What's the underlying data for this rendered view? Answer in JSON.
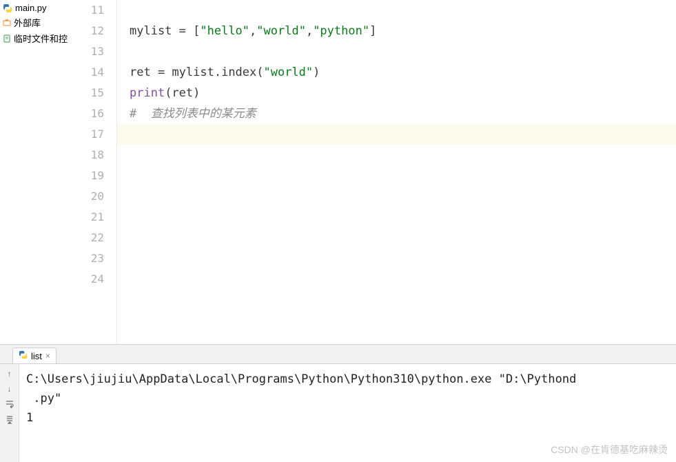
{
  "sidebar": {
    "items": [
      {
        "label": "main.py",
        "icon": "python-file-icon"
      },
      {
        "label": "外部库",
        "icon": "external-lib-icon"
      },
      {
        "label": "临时文件和控",
        "icon": "scratch-icon"
      }
    ]
  },
  "editor": {
    "lines": [
      {
        "num": "11",
        "tokens": []
      },
      {
        "num": "12",
        "tokens": [
          {
            "t": "mylist ",
            "c": "tok-default"
          },
          {
            "t": "= [",
            "c": "tok-punct"
          },
          {
            "t": "\"hello\"",
            "c": "tok-string"
          },
          {
            "t": ",",
            "c": "tok-punct"
          },
          {
            "t": "\"world\"",
            "c": "tok-string"
          },
          {
            "t": ",",
            "c": "tok-punct"
          },
          {
            "t": "\"python\"",
            "c": "tok-string"
          },
          {
            "t": "]",
            "c": "tok-punct"
          }
        ]
      },
      {
        "num": "13",
        "tokens": []
      },
      {
        "num": "14",
        "tokens": [
          {
            "t": "ret ",
            "c": "tok-default"
          },
          {
            "t": "= ",
            "c": "tok-punct"
          },
          {
            "t": "mylist.index(",
            "c": "tok-default"
          },
          {
            "t": "\"world\"",
            "c": "tok-string"
          },
          {
            "t": ")",
            "c": "tok-punct"
          }
        ]
      },
      {
        "num": "15",
        "tokens": [
          {
            "t": "print",
            "c": "tok-builtin"
          },
          {
            "t": "(ret)",
            "c": "tok-default"
          }
        ]
      },
      {
        "num": "16",
        "tokens": [
          {
            "t": "#  查找列表中的某元素",
            "c": "tok-comment"
          }
        ]
      },
      {
        "num": "17",
        "tokens": [],
        "highlighted": true
      },
      {
        "num": "18",
        "tokens": []
      },
      {
        "num": "19",
        "tokens": []
      },
      {
        "num": "20",
        "tokens": []
      },
      {
        "num": "21",
        "tokens": []
      },
      {
        "num": "22",
        "tokens": []
      },
      {
        "num": "23",
        "tokens": []
      },
      {
        "num": "24",
        "tokens": []
      }
    ]
  },
  "console": {
    "tab_label": "list",
    "output_line1": "C:\\Users\\jiujiu\\AppData\\Local\\Programs\\Python\\Python310\\python.exe \"D:\\Pythond",
    "output_line2": ".py\"",
    "output_line3": "1"
  },
  "watermark": "CSDN @在肯德基吃麻辣烫"
}
